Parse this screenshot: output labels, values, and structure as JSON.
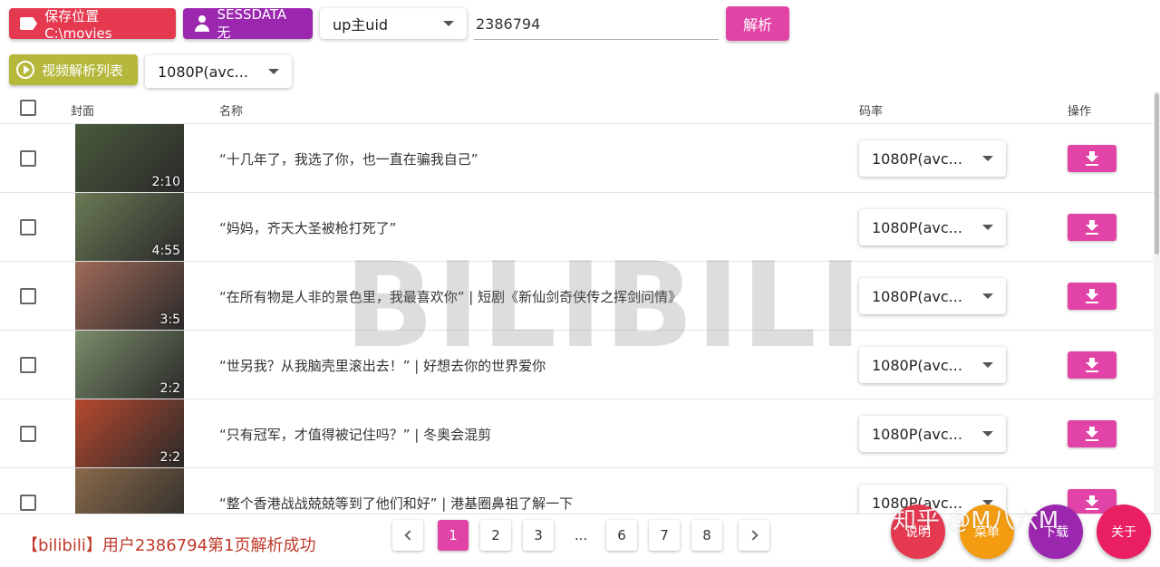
{
  "toolbar": {
    "save_location": "保存位置 C:\\movies",
    "sessdata": "SESSDATA 无",
    "type_select": "up主uid",
    "uid_value": "2386794",
    "parse_button": "解析",
    "list_button": "视频解析列表",
    "quality_select": "1080P(avc..."
  },
  "table": {
    "headers": {
      "cover": "封面",
      "name": "名称",
      "bitrate": "码率",
      "action": "操作"
    },
    "rows": [
      {
        "title": "“十几年了，我选了你，也一直在骗我自己”",
        "duration": "2:10",
        "quality": "1080P(avc...",
        "thumb_color": "#4a5a3c"
      },
      {
        "title": "“妈妈，齐天大圣被枪打死了”",
        "duration": "4:55",
        "quality": "1080P(avc...",
        "thumb_color": "#6b7a55"
      },
      {
        "title": "“在所有物是人非的景色里，我最喜欢你” | 短剧《新仙剑奇侠传之挥剑问情》",
        "duration": "3:5",
        "quality": "1080P(avc...",
        "thumb_color": "#a06a5a"
      },
      {
        "title": "“世另我？从我脑壳里滚出去！” | 好想去你的世界爱你",
        "duration": "2:2",
        "quality": "1080P(avc...",
        "thumb_color": "#7a8c6a"
      },
      {
        "title": "“只有冠军，才值得被记住吗？” | 冬奥会混剪",
        "duration": "2:2",
        "quality": "1080P(avc...",
        "thumb_color": "#b54a2e"
      },
      {
        "title": "“整个香港战战兢兢等到了他们和好” | 港基圈鼻祖了解一下",
        "duration": "",
        "quality": "1080P(avc...",
        "thumb_color": "#8a6a4a"
      }
    ]
  },
  "watermark": "BILIBILI",
  "footer": {
    "status": "【bilibili】用户2386794第1页解析成功",
    "pages": [
      "1",
      "2",
      "3",
      "...",
      "6",
      "7",
      "8"
    ],
    "fab_labels": [
      "说明",
      "菜单",
      "下载",
      "关于"
    ],
    "zhihu_watermark": "知乎 @M八六M"
  },
  "colors": {
    "accent": "#e144a6",
    "save": "#e53950",
    "sessdata": "#9b27af",
    "list": "#b5b83a",
    "fab_red": "#e53950",
    "fab_orange": "#f39c12",
    "fab_purple": "#9b27af",
    "fab_pink": "#e91e63"
  }
}
